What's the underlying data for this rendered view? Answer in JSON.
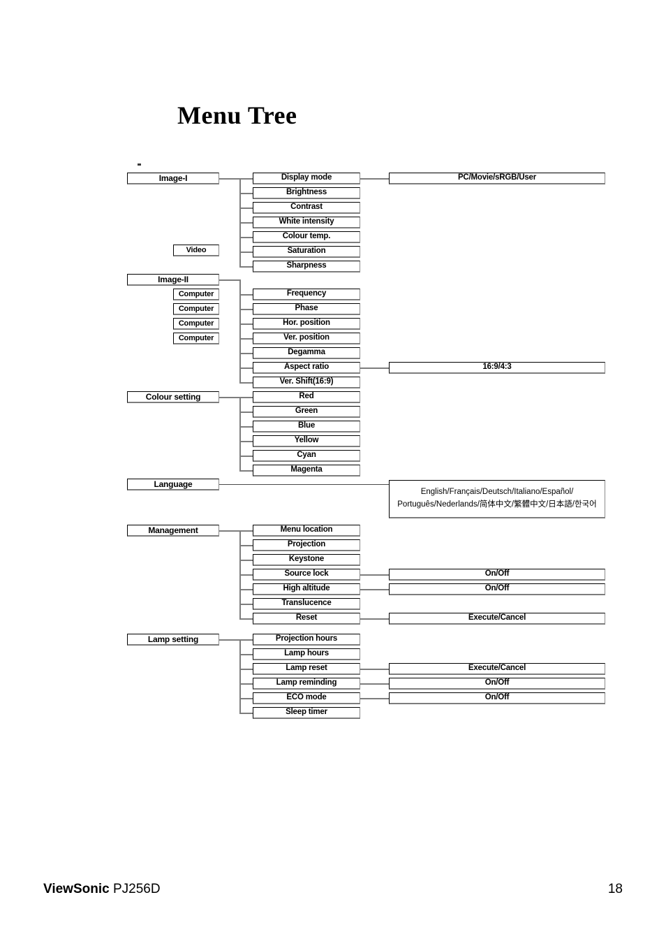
{
  "document": {
    "title": "Menu Tree",
    "footer": {
      "brand": "ViewSonic",
      "model": "PJ256D",
      "page_number": "18"
    }
  },
  "chart_data": {
    "type": "diagram",
    "subtype": "menu-tree",
    "title": "Menu Tree",
    "columns": [
      "top-level menu",
      "source label",
      "menu item",
      "value options"
    ],
    "nodes": {
      "image_i": {
        "label": "Image-I",
        "source_label": "Video",
        "items": [
          {
            "label": "Display mode",
            "value": "PC/Movie/sRGB/User"
          },
          {
            "label": "Brightness",
            "value": ""
          },
          {
            "label": "Contrast",
            "value": ""
          },
          {
            "label": "White intensity",
            "value": ""
          },
          {
            "label": "Colour temp.",
            "value": ""
          },
          {
            "label": "Saturation",
            "value": ""
          },
          {
            "label": "Sharpness",
            "value": ""
          }
        ]
      },
      "image_ii": {
        "label": "Image-II",
        "source_labels": [
          "Computer",
          "Computer",
          "Computer",
          "Computer"
        ],
        "items": [
          {
            "label": "Frequency",
            "value": ""
          },
          {
            "label": "Phase",
            "value": ""
          },
          {
            "label": "Hor. position",
            "value": ""
          },
          {
            "label": "Ver. position",
            "value": ""
          },
          {
            "label": "Degamma",
            "value": ""
          },
          {
            "label": "Aspect ratio",
            "value": "16:9/4:3"
          },
          {
            "label": "Ver. Shift(16:9)",
            "value": ""
          }
        ]
      },
      "colour_setting": {
        "label": "Colour setting",
        "items": [
          {
            "label": "Red",
            "value": ""
          },
          {
            "label": "Green",
            "value": ""
          },
          {
            "label": "Blue",
            "value": ""
          },
          {
            "label": "Yellow",
            "value": ""
          },
          {
            "label": "Cyan",
            "value": ""
          },
          {
            "label": "Magenta",
            "value": ""
          }
        ]
      },
      "language": {
        "label": "Language",
        "value_lines": [
          "English/Français/Deutsch/Italiano/Español/",
          "Português/Nederlands/简体中文/繁體中文/日本語/한국어"
        ]
      },
      "management": {
        "label": "Management",
        "items": [
          {
            "label": "Menu location",
            "value": ""
          },
          {
            "label": "Projection",
            "value": ""
          },
          {
            "label": "Keystone",
            "value": ""
          },
          {
            "label": "Source lock",
            "value": "On/Off"
          },
          {
            "label": "High altitude",
            "value": "On/Off"
          },
          {
            "label": "Translucence",
            "value": ""
          },
          {
            "label": "Reset",
            "value": "Execute/Cancel"
          }
        ]
      },
      "lamp_setting": {
        "label": "Lamp setting",
        "items": [
          {
            "label": "Projection hours",
            "value": ""
          },
          {
            "label": "Lamp hours",
            "value": ""
          },
          {
            "label": "Lamp reset",
            "value": "Execute/Cancel"
          },
          {
            "label": "Lamp reminding",
            "value": "On/Off"
          },
          {
            "label": "ECO mode",
            "value": "On/Off"
          },
          {
            "label": "Sleep timer",
            "value": ""
          }
        ]
      }
    },
    "colors": {
      "box_border": "#000000",
      "box_shadow": "#7d7d7d",
      "line": "#7d7d7d",
      "text": "#000000",
      "background": "#ffffff"
    }
  }
}
